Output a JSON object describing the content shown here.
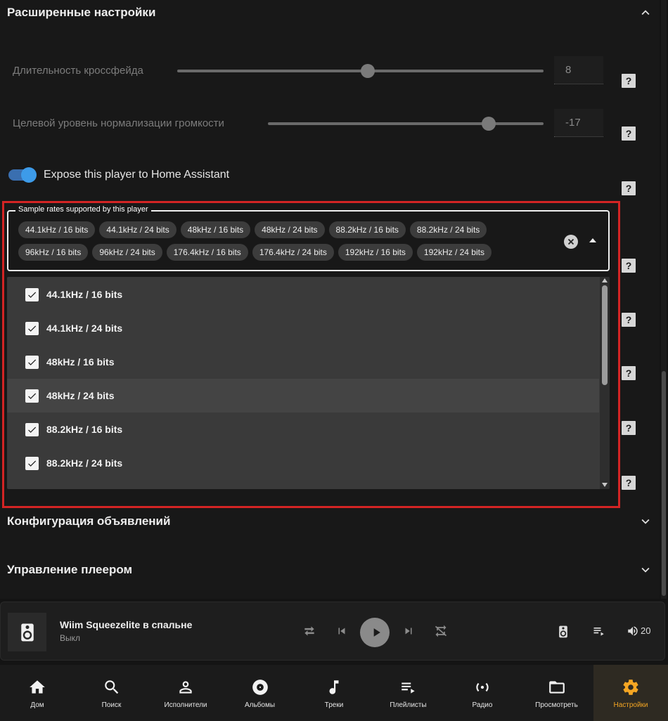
{
  "advanced": {
    "title": "Расширенные настройки",
    "crossfade_label": "Длительность кроссфейда",
    "crossfade_value": "8",
    "crossfade_level": 0.52,
    "normalization_label": "Целевой уровень нормализации громкости",
    "normalization_value": "-17",
    "normalization_level": 0.8,
    "help_glyph": "?",
    "expose_label": "Expose this player to Home Assistant",
    "expose_on": true
  },
  "sample_rates": {
    "legend": "Sample rates supported by this player",
    "chips": [
      "44.1kHz / 16 bits",
      "44.1kHz / 24 bits",
      "48kHz / 16 bits",
      "48kHz / 24 bits",
      "88.2kHz / 16 bits",
      "88.2kHz / 24 bits",
      "96kHz / 16 bits",
      "96kHz / 24 bits",
      "176.4kHz / 16 bits",
      "176.4kHz / 24 bits",
      "192kHz / 16 bits",
      "192kHz / 24 bits"
    ],
    "options": [
      {
        "label": "44.1kHz / 16 bits",
        "checked": true
      },
      {
        "label": "44.1kHz / 24 bits",
        "checked": true
      },
      {
        "label": "48kHz / 16 bits",
        "checked": true
      },
      {
        "label": "48kHz / 24 bits",
        "checked": true
      },
      {
        "label": "88.2kHz / 16 bits",
        "checked": true
      },
      {
        "label": "88.2kHz / 24 bits",
        "checked": true
      }
    ]
  },
  "sections": {
    "announcements": "Конфигурация объявлений",
    "player_control": "Управление плеером"
  },
  "player": {
    "title": "Wiim Squeezelite в спальне",
    "status": "Выкл",
    "volume": "20"
  },
  "nav": [
    {
      "label": "Дом",
      "icon": "home-icon"
    },
    {
      "label": "Поиск",
      "icon": "search-icon"
    },
    {
      "label": "Исполнители",
      "icon": "person-icon"
    },
    {
      "label": "Альбомы",
      "icon": "disc-icon"
    },
    {
      "label": "Треки",
      "icon": "music-note-icon"
    },
    {
      "label": "Плейлисты",
      "icon": "playlist-icon"
    },
    {
      "label": "Радио",
      "icon": "radio-icon"
    },
    {
      "label": "Просмотреть",
      "icon": "folder-icon"
    },
    {
      "label": "Настройки",
      "icon": "gear-icon",
      "active": true
    }
  ],
  "colors": {
    "accent": "#f5a623",
    "toggle": "#3d9be9",
    "highlight": "#d32424"
  }
}
